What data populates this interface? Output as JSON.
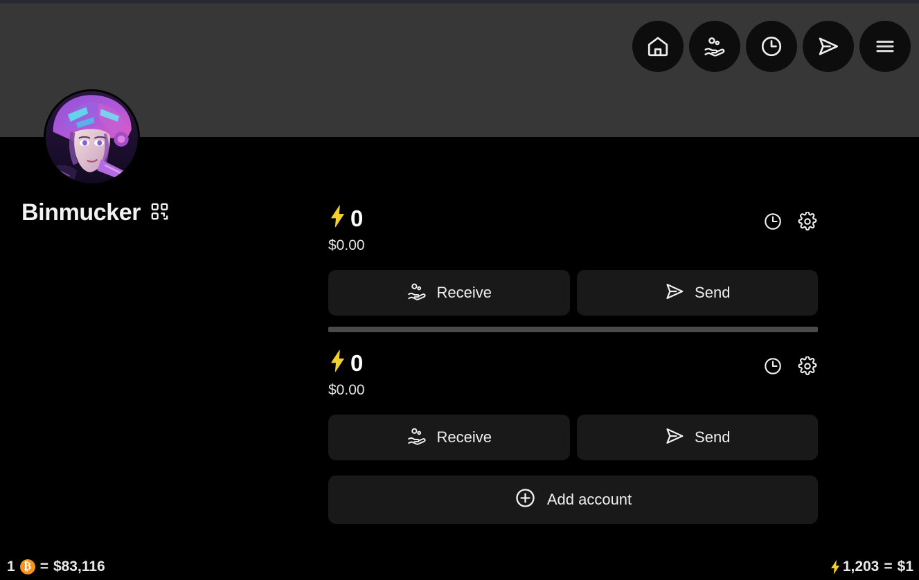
{
  "app": {
    "theme_bg": "#000000",
    "header_bg": "#373737",
    "accent_yellow": "#f5d13b",
    "bitcoin_orange": "#f7931a"
  },
  "header": {
    "nav": [
      {
        "name": "home",
        "label": "Home"
      },
      {
        "name": "receive",
        "label": "Receive"
      },
      {
        "name": "history",
        "label": "History"
      },
      {
        "name": "send",
        "label": "Send"
      },
      {
        "name": "menu",
        "label": "Menu"
      }
    ]
  },
  "profile": {
    "name": "Binmucker",
    "avatar_alt": "Cyberpunk anime avatar with purple helmet",
    "qr_icon": "qr-code-icon"
  },
  "accounts": [
    {
      "balance_symbol": "⚡",
      "balance": "0",
      "fiat": "$0.00",
      "history_icon": "clock-icon",
      "settings_icon": "gear-icon",
      "receive_label": "Receive",
      "send_label": "Send"
    },
    {
      "balance_symbol": "⚡",
      "balance": "0",
      "fiat": "$0.00",
      "history_icon": "clock-icon",
      "settings_icon": "gear-icon",
      "receive_label": "Receive",
      "send_label": "Send"
    }
  ],
  "add_account": {
    "label": "Add account",
    "icon": "plus-circle-icon"
  },
  "statusbar": {
    "btc_prefix": "1",
    "btc_symbol": "₿",
    "btc_equals": "=",
    "btc_price": "$83,116",
    "sats_symbol": "⚡",
    "sats_amount": "1,203",
    "sats_equals": "=",
    "sats_value": "$1"
  }
}
